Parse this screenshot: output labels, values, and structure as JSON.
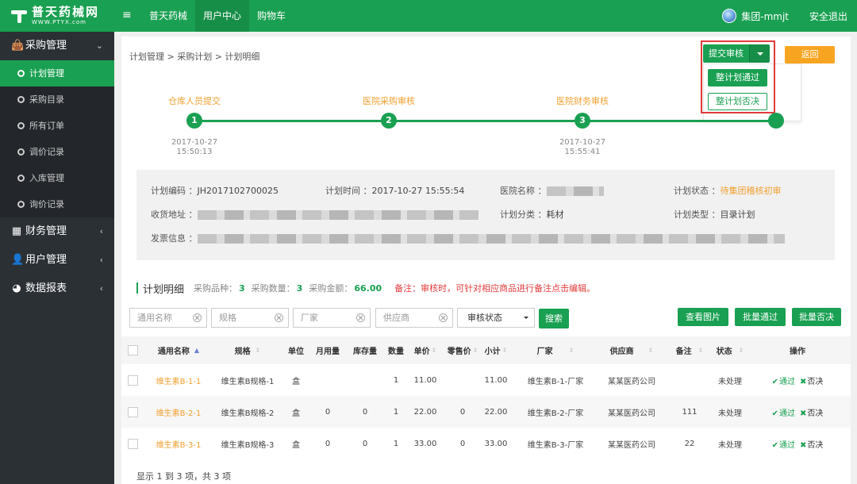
{
  "logo": {
    "cn": "普天药械网",
    "en": "WWW.PTYX.com"
  },
  "nav": [
    "普天药械",
    "用户中心",
    "购物车"
  ],
  "user": {
    "name": "集团-mmjt",
    "logout": "安全退出"
  },
  "sidebar": {
    "purchase": {
      "label": "采购管理",
      "items": [
        "计划管理",
        "采购目录",
        "所有订单",
        "调价记录",
        "入库管理",
        "询价记录"
      ]
    },
    "groups": [
      "财务管理",
      "用户管理",
      "数据报表"
    ]
  },
  "breadcrumb": "计划管理  >  采购计划  >  计划明细",
  "actions": {
    "submit": "提交审核",
    "approve_all": "整计划通过",
    "reject_all": "整计划否决",
    "back": "返回"
  },
  "steps": [
    {
      "num": "1",
      "label": "仓库人员提交",
      "date": "2017-10-27",
      "time": "15:50:13"
    },
    {
      "num": "2",
      "label": "医院采购审核",
      "date": "",
      "time": ""
    },
    {
      "num": "3",
      "label": "医院财务审核",
      "date": "2017-10-27",
      "time": "15:55:41"
    }
  ],
  "info": {
    "plan_code_label": "计划编码 ：",
    "plan_code": "JH2017102700025",
    "plan_time_label": "计划时间 ：",
    "plan_time": "2017-10-27 15:55:54",
    "hospital_label": "医院名称 ：",
    "status_label": "计划状态 ：",
    "status": "待集团稽核初审",
    "address_label": "收货地址 ：",
    "category_label": "计划分类 ：",
    "category": "耗材",
    "type_label": "计划类型 ：",
    "type": "目录计划",
    "invoice_label": "发票信息 ："
  },
  "detail": {
    "title": "计划明细",
    "variety_label": "采购品种：",
    "variety": "3",
    "qty_label": "采购数量：",
    "qty": "3",
    "amount_label": "采购金额：",
    "amount": "66.00",
    "remark": "备注：审核时，可针对相应商品进行备注点击编辑。"
  },
  "filters": {
    "generic_name": "通用名称",
    "spec": "规格",
    "manufacturer": "厂家",
    "supplier": "供应商",
    "status": "审核状态",
    "search": "搜索"
  },
  "tools": {
    "view_images": "查看图片",
    "batch_approve": "批量通过",
    "batch_reject": "批量否决"
  },
  "table": {
    "headers": [
      "通用名称",
      "规格",
      "单位",
      "月用量",
      "库存量",
      "数量",
      "单价",
      "零售价",
      "小计",
      "厂家",
      "供应商",
      "备注",
      "状态",
      "操作"
    ],
    "approve": "通过",
    "reject": "否决",
    "rows": [
      {
        "name": "维生素B-1-1",
        "spec": "维生素B规格-1",
        "unit": "盒",
        "monthly": "",
        "stock": "",
        "qty": "1",
        "price": "11.00",
        "retail": "",
        "subtotal": "11.00",
        "maker": "维生素B-1-厂家",
        "supplier": "某某医药公司",
        "note": "",
        "status": "未处理"
      },
      {
        "name": "维生素B-2-1",
        "spec": "维生素B规格-2",
        "unit": "盒",
        "monthly": "0",
        "stock": "0",
        "qty": "1",
        "price": "22.00",
        "retail": "0",
        "subtotal": "22.00",
        "maker": "维生素B-2-厂家",
        "supplier": "某某医药公司",
        "note": "111",
        "status": "未处理"
      },
      {
        "name": "维生素B-3-1",
        "spec": "维生素B规格-3",
        "unit": "盒",
        "monthly": "0",
        "stock": "0",
        "qty": "1",
        "price": "33.00",
        "retail": "0",
        "subtotal": "33.00",
        "maker": "维生素B-3-厂家",
        "supplier": "某某医药公司",
        "note": "22",
        "status": "未处理"
      }
    ]
  },
  "pagination": "显示 1 到 3 项，共 3 项"
}
